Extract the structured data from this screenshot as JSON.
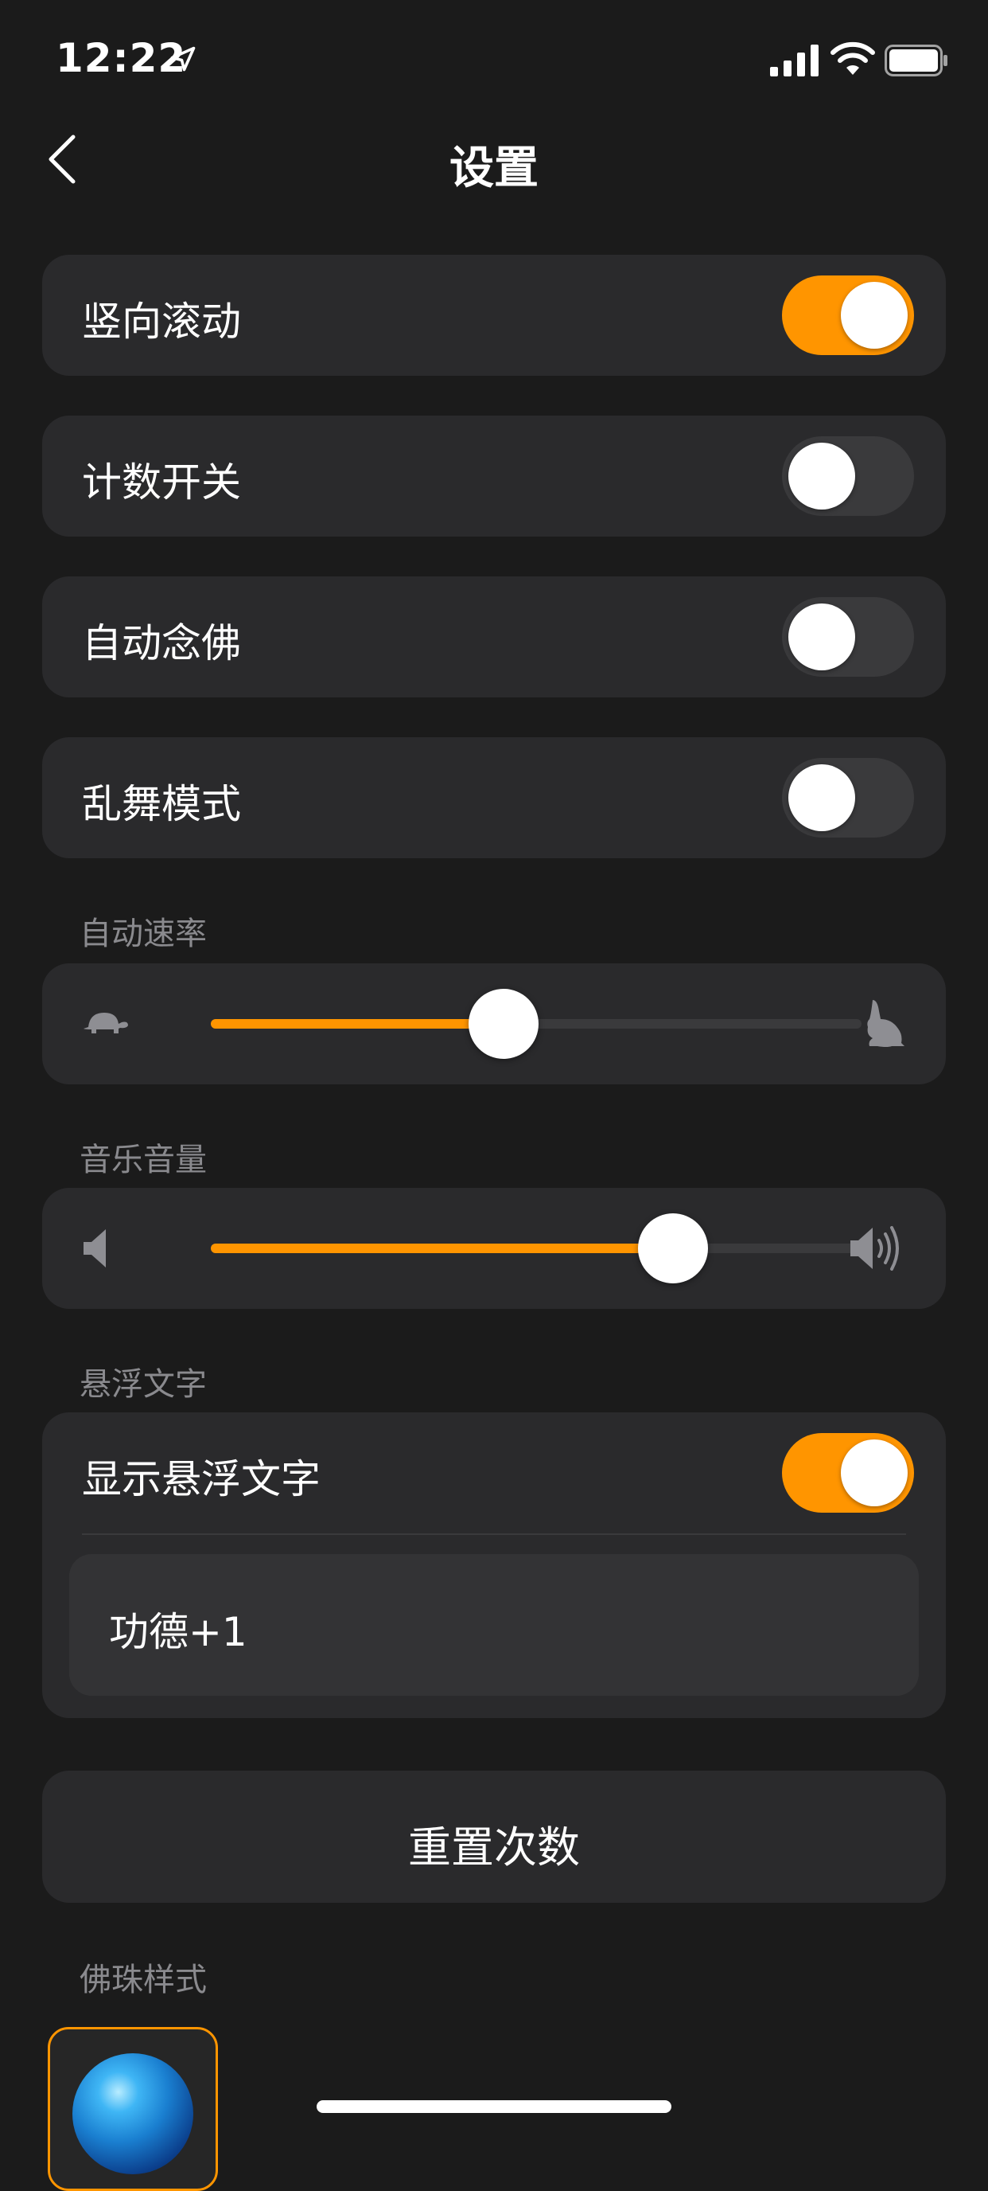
{
  "status_bar": {
    "time": "12:22",
    "icons": [
      "location-arrow-icon",
      "cellular-signal-icon",
      "wifi-icon",
      "battery-icon"
    ]
  },
  "nav": {
    "title": "设置",
    "back_icon": "chevron-left-icon"
  },
  "settings": {
    "vertical_scroll": {
      "label": "竖向滚动",
      "on": true
    },
    "counter": {
      "label": "计数开关",
      "on": false
    },
    "auto_chant": {
      "label": "自动念佛",
      "on": false
    },
    "chaos_mode": {
      "label": "乱舞模式",
      "on": false
    }
  },
  "auto_rate": {
    "section_label": "自动速率",
    "value": 0.45,
    "min_icon": "turtle-icon",
    "max_icon": "rabbit-icon"
  },
  "music_volume": {
    "section_label": "音乐音量",
    "value": 0.71,
    "min_icon": "speaker-low-icon",
    "max_icon": "speaker-high-icon"
  },
  "floating_text": {
    "section_label": "悬浮文字",
    "show": {
      "label": "显示悬浮文字",
      "on": true
    },
    "text_value": "功德+1"
  },
  "reset": {
    "label": "重置次数"
  },
  "bead_style": {
    "section_label": "佛珠样式",
    "selected": "blue-glass-bead"
  },
  "colors": {
    "accent": "#ff9500",
    "background": "#1b1b1b",
    "card": "#2a2a2c",
    "toggle_off": "#3a3a3c",
    "secondary_text": "#8a8a8e"
  }
}
